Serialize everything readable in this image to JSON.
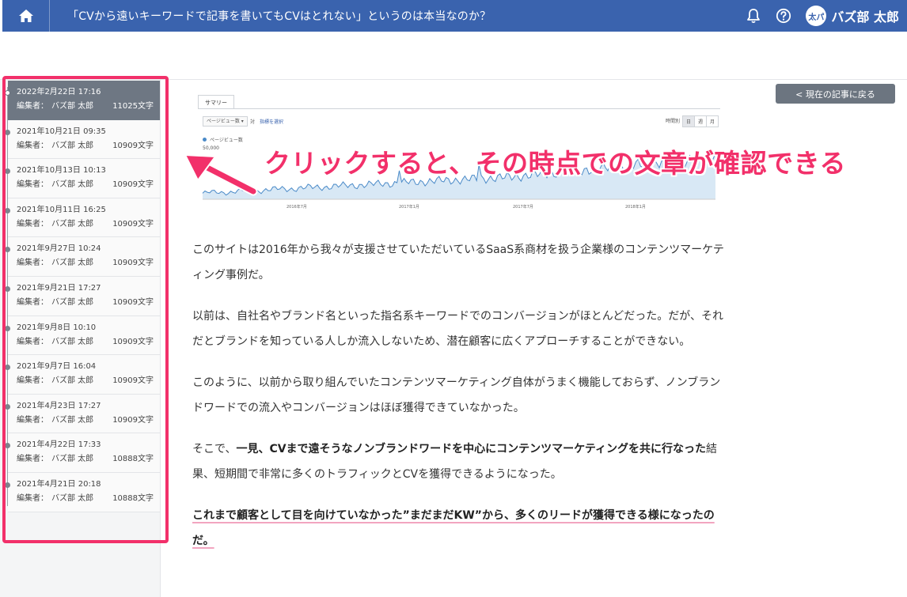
{
  "header": {
    "title": "「CVから遠いキーワードで記事を書いてもCVはとれない」というのは本当なのか？",
    "home_icon": "home-icon",
    "bell_icon": "bell-icon",
    "help_icon": "question-circle-icon",
    "avatar_text": "太パ",
    "user_name": "バズ部 太郎"
  },
  "sidebar": {
    "editor_label": "編集者：",
    "items": [
      {
        "date": "2022年2月22日 17:16",
        "editor": "バズ部 太郎",
        "chars": "11025文字",
        "active": true
      },
      {
        "date": "2021年10月21日 09:35",
        "editor": "バズ部 太郎",
        "chars": "10909文字"
      },
      {
        "date": "2021年10月13日 10:13",
        "editor": "バズ部 太郎",
        "chars": "10909文字"
      },
      {
        "date": "2021年10月11日 16:25",
        "editor": "バズ部 太郎",
        "chars": "10909文字"
      },
      {
        "date": "2021年9月27日 10:24",
        "editor": "バズ部 太郎",
        "chars": "10909文字"
      },
      {
        "date": "2021年9月21日 17:27",
        "editor": "バズ部 太郎",
        "chars": "10909文字"
      },
      {
        "date": "2021年9月8日 10:10",
        "editor": "バズ部 太郎",
        "chars": "10909文字"
      },
      {
        "date": "2021年9月7日 16:04",
        "editor": "バズ部 太郎",
        "chars": "10909文字"
      },
      {
        "date": "2021年4月23日 17:27",
        "editor": "バズ部 太郎",
        "chars": "10909文字"
      },
      {
        "date": "2021年4月22日 17:33",
        "editor": "バズ部 太郎",
        "chars": "10888文字"
      },
      {
        "date": "2021年4月21日 20:18",
        "editor": "バズ部 太郎",
        "chars": "10888文字"
      }
    ]
  },
  "back_button": "< 現在の記事に戻る",
  "callout": "クリックすると、その時点での文章が確認できる",
  "analytics": {
    "tab": "サマリー",
    "metric_select": "ページビュー数 ▾",
    "vs": "対",
    "pick_metric": "指標を選択",
    "range_label": "時間別",
    "range_day": "日",
    "range_week": "週",
    "range_month": "月",
    "legend": "ページビュー数",
    "y_max": "50,000",
    "x_labels": [
      "2016年7月",
      "2017年1月",
      "2017年7月",
      "2018年1月"
    ]
  },
  "article": {
    "p1": "このサイトは2016年から我々が支援させていただいているSaaS系商材を扱う企業様のコンテンツマーケティング事例だ。",
    "p2": "以前は、自社名やブランド名といった指名系キーワードでのコンバージョンがほとんどだった。だが、それだとブランドを知っている人しか流入しないため、潜在顧客に広くアプローチすることができない。",
    "p3": "このように、以前から取り組んでいたコンテンツマーケティング自体がうまく機能しておらず、ノンブランドワードでの流入やコンバージョンはほぼ獲得できていなかった。",
    "p4_pre": "そこで、",
    "p4_bold": "一見、CVまで遠そうなノンブランドワードを中心にコンテンツマーケティングを共に行なった",
    "p4_post": "結果、短期間で非常に多くのトラフィックとCVを獲得できるようになった。",
    "p5": "これまで顧客として目を向けていなかった”まだまだKW”から、多くのリードが獲得できる様になったのだ。"
  }
}
